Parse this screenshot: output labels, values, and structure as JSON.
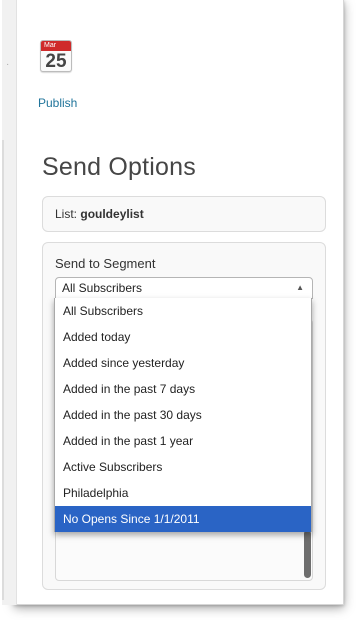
{
  "calendar": {
    "month": "Mar",
    "day": "25"
  },
  "publish_link": "Publish",
  "page_title": "Send Options",
  "list": {
    "label": "List:",
    "value": "gouldeylist"
  },
  "segment": {
    "label": "Send to Segment",
    "selected": "All Subscribers",
    "options": [
      "All Subscribers",
      "Added today",
      "Added since yesterday",
      "Added in the past 7 days",
      "Added in the past 30 days",
      "Added in the past 1 year",
      "Active Subscribers",
      "Philadelphia",
      "No Opens Since 1/1/2011"
    ],
    "highlighted_index": 8
  },
  "icons": {
    "calendar": "calendar-icon",
    "dropdown": "chevron-up-icon"
  },
  "colors": {
    "highlight": "#2a64c5",
    "link": "#21759b",
    "calendar_red": "#cf2a2a"
  }
}
